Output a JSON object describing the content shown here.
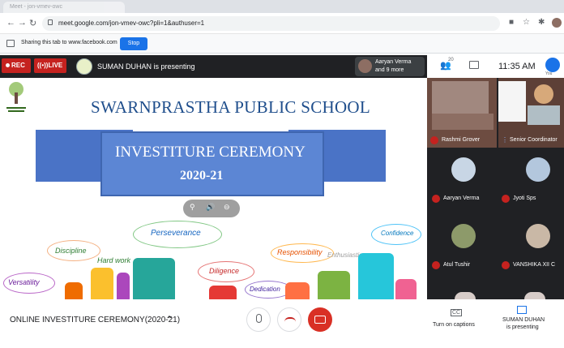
{
  "browser": {
    "tab_title": "Meet - jon-vmev-owc",
    "url": "meet.google.com/jon-vmev-owc?pli=1&authuser=1"
  },
  "share_bar": {
    "message": "Sharing this tab to www.facebook.com",
    "stop_label": "Stop"
  },
  "meet_top": {
    "rec_label": "REC",
    "live_label": "LIVE",
    "presenting_text": "SUMAN DUHAN is presenting",
    "viewer_name": "Aaryan Verma",
    "viewer_more": "and 9 more"
  },
  "right_header": {
    "people_count": "20",
    "clock": "11:35 AM",
    "you_label": "You"
  },
  "slide": {
    "school_name": "SWARNPRASTHA PUBLIC SCHOOL",
    "ceremony_title": "INVESTITURE CEREMONY",
    "year": "2020-21",
    "words": [
      "Discipline",
      "Perseverance",
      "Confidence",
      "Hard work",
      "Responsibility",
      "Enthusiastic",
      "Versatility",
      "Diligence",
      "Dedication"
    ]
  },
  "participants": [
    {
      "name": "Rashmi Grover"
    },
    {
      "name": "Senior Coordinator"
    },
    {
      "name": "Aaryan Verma"
    },
    {
      "name": "Jyoti Sps"
    },
    {
      "name": "Atul Tushir"
    },
    {
      "name": "VANSHIKA XII C"
    }
  ],
  "bottom": {
    "meeting_name": "ONLINE INVESTITURE CEREMONY(2020-21)",
    "cc_icon_text": "CC",
    "captions_label": "Turn on captions",
    "presenting_l1": "SUMAN DUHAN",
    "presenting_l2": "is presenting"
  },
  "colors": {
    "rec": "#c5221f",
    "banner": "#5c86d4",
    "school": "#1f4e8c",
    "accent": "#1a73e8"
  }
}
